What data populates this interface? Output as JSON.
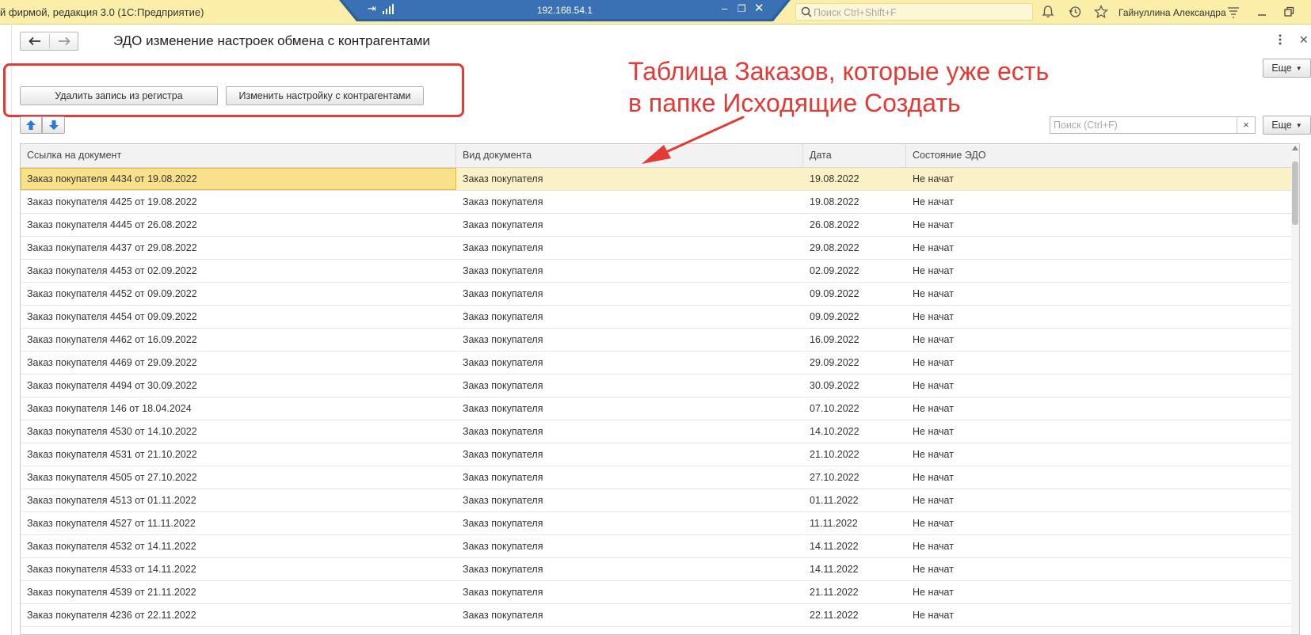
{
  "titlebar": {
    "app_title": "й фирмой, редакция 3.0  (1С:Предприятие)",
    "rdp_ip": "192.168.54.1",
    "search_placeholder": "Поиск Ctrl+Shift+F",
    "user_name": "Гайнуллина Александра"
  },
  "form": {
    "title": "ЭДО изменение настроек обмена с контрагентами",
    "more_label": "Еще",
    "buttons": {
      "delete": "Удалить запись из регистра",
      "change": "Изменить настройку с контрагентами"
    },
    "table_search_placeholder": "Поиск (Ctrl+F)",
    "clear_label": "×",
    "more_label_2": "Еще"
  },
  "annotation": {
    "line1": "Таблица Заказов, которые уже есть",
    "line2": "в папке Исходящие Создать",
    "color": "#e53935"
  },
  "table": {
    "columns": [
      "Ссылка на документ",
      "Вид документа",
      "Дата",
      "Состояние ЭДО"
    ],
    "selected_index": 0,
    "rows": [
      [
        "Заказ покупателя 4434 от 19.08.2022",
        "Заказ покупателя",
        "19.08.2022",
        "Не начат"
      ],
      [
        "Заказ покупателя 4425 от 19.08.2022",
        "Заказ покупателя",
        "19.08.2022",
        "Не начат"
      ],
      [
        "Заказ покупателя 4445 от 26.08.2022",
        "Заказ покупателя",
        "26.08.2022",
        "Не начат"
      ],
      [
        "Заказ покупателя 4437 от 29.08.2022",
        "Заказ покупателя",
        "29.08.2022",
        "Не начат"
      ],
      [
        "Заказ покупателя 4453 от 02.09.2022",
        "Заказ покупателя",
        "02.09.2022",
        "Не начат"
      ],
      [
        "Заказ покупателя 4452 от 09.09.2022",
        "Заказ покупателя",
        "09.09.2022",
        "Не начат"
      ],
      [
        "Заказ покупателя 4454 от 09.09.2022",
        "Заказ покупателя",
        "09.09.2022",
        "Не начат"
      ],
      [
        "Заказ покупателя 4462 от 16.09.2022",
        "Заказ покупателя",
        "16.09.2022",
        "Не начат"
      ],
      [
        "Заказ покупателя 4469 от 29.09.2022",
        "Заказ покупателя",
        "29.09.2022",
        "Не начат"
      ],
      [
        "Заказ покупателя 4494 от 30.09.2022",
        "Заказ покупателя",
        "30.09.2022",
        "Не начат"
      ],
      [
        "Заказ покупателя 146 от 18.04.2024",
        "Заказ покупателя",
        "07.10.2022",
        "Не начат"
      ],
      [
        "Заказ покупателя 4530 от 14.10.2022",
        "Заказ покупателя",
        "14.10.2022",
        "Не начат"
      ],
      [
        "Заказ покупателя 4531 от 21.10.2022",
        "Заказ покупателя",
        "21.10.2022",
        "Не начат"
      ],
      [
        "Заказ покупателя 4505 от 27.10.2022",
        "Заказ покупателя",
        "27.10.2022",
        "Не начат"
      ],
      [
        "Заказ покупателя 4513 от 01.11.2022",
        "Заказ покупателя",
        "01.11.2022",
        "Не начат"
      ],
      [
        "Заказ покупателя 4527 от 11.11.2022",
        "Заказ покупателя",
        "11.11.2022",
        "Не начат"
      ],
      [
        "Заказ покупателя 4532 от 14.11.2022",
        "Заказ покупателя",
        "14.11.2022",
        "Не начат"
      ],
      [
        "Заказ покупателя 4533 от 14.11.2022",
        "Заказ покупателя",
        "14.11.2022",
        "Не начат"
      ],
      [
        "Заказ покупателя 4539 от 21.11.2022",
        "Заказ покупателя",
        "21.11.2022",
        "Не начат"
      ],
      [
        "Заказ покупателя 4236 от 22.11.2022",
        "Заказ покупателя",
        "22.11.2022",
        "Не начат"
      ]
    ]
  }
}
